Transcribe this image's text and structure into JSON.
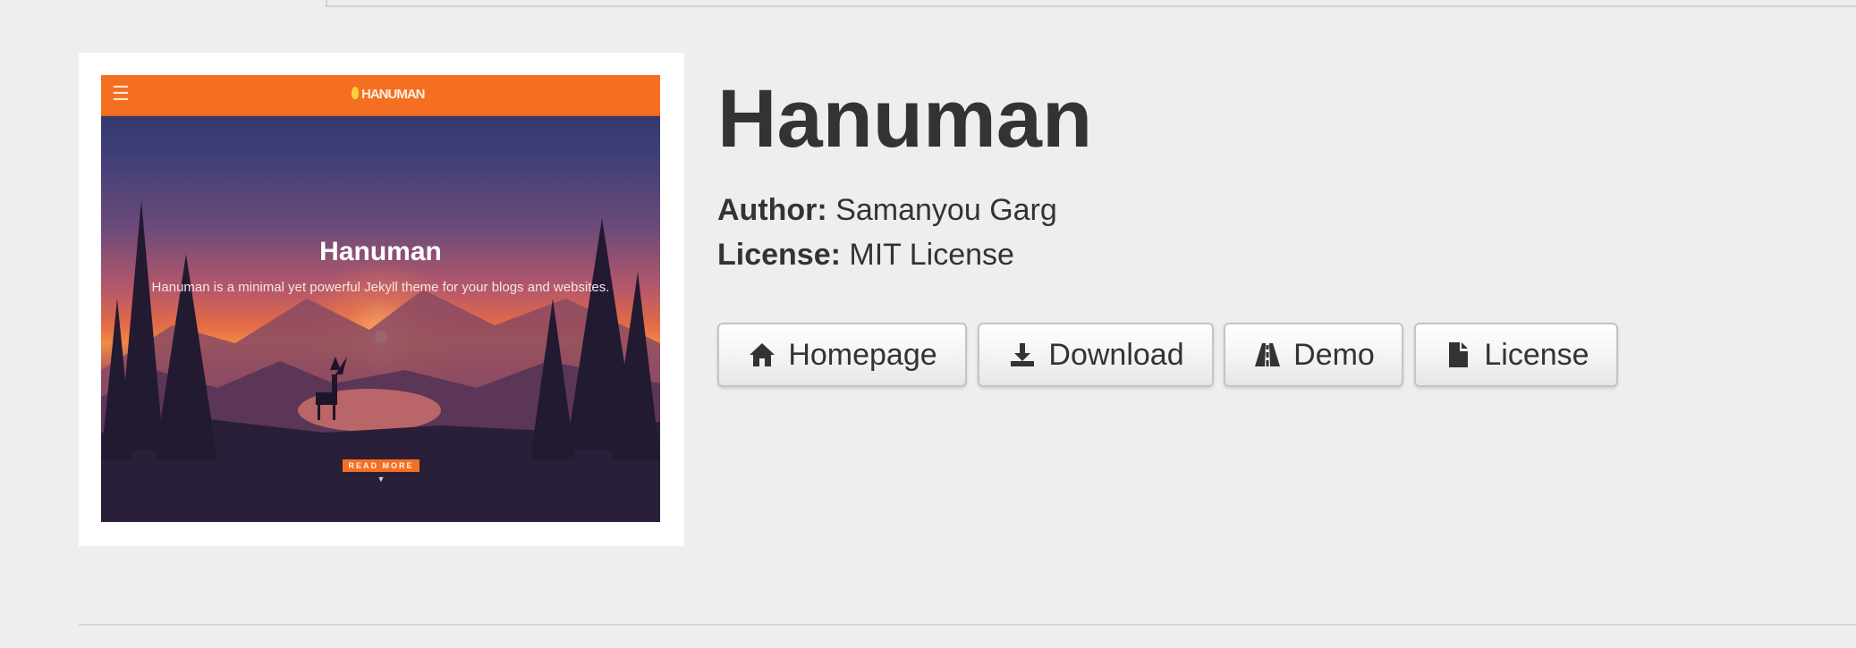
{
  "project": {
    "title": "Hanuman",
    "author_label": "Author:",
    "author": "Samanyou Garg",
    "license_label": "License:",
    "license": "MIT License"
  },
  "preview": {
    "logo_text": "HANUMAN",
    "title": "Hanuman",
    "subtitle": "Hanuman is a minimal yet powerful Jekyll theme for your blogs and websites.",
    "button_label": "READ MORE",
    "menu_icon": "hamburger-icon",
    "bar_color": "#f46f22"
  },
  "buttons": {
    "homepage": {
      "label": "Homepage",
      "icon": "home-icon"
    },
    "download": {
      "label": "Download",
      "icon": "download-icon"
    },
    "demo": {
      "label": "Demo",
      "icon": "road-icon"
    },
    "license": {
      "label": "License",
      "icon": "file-icon"
    }
  }
}
